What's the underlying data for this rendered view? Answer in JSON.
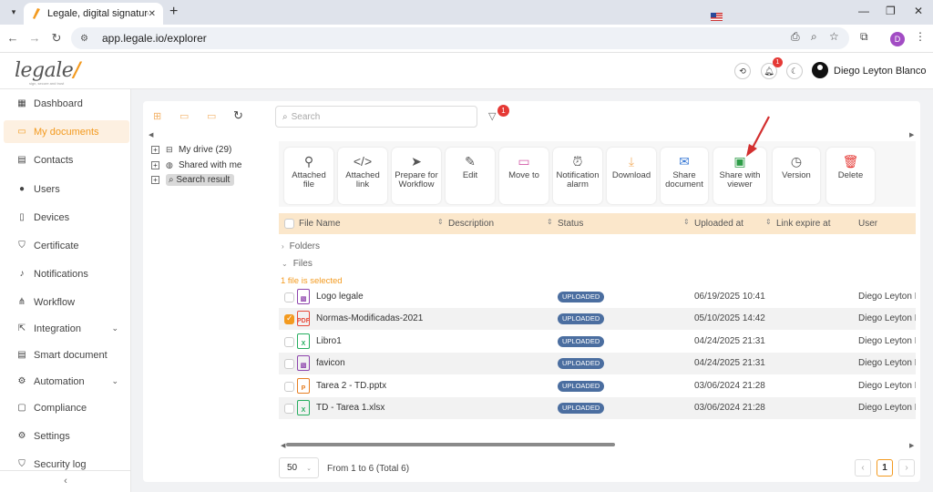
{
  "browser": {
    "tab_title": "Legale, digital signature",
    "url": "app.legale.io/explorer",
    "profile_initial": "D"
  },
  "header": {
    "logo": "legale",
    "logo_tagline": "sign, secure and trust",
    "notification_count": "1",
    "user_name": "Diego Leyton Blanco"
  },
  "sidebar": {
    "items": [
      {
        "label": "Dashboard",
        "icon": "dashboard-icon"
      },
      {
        "label": "My documents",
        "icon": "folder-icon",
        "active": true
      },
      {
        "label": "Contacts",
        "icon": "contacts-icon"
      },
      {
        "label": "Users",
        "icon": "user-icon"
      },
      {
        "label": "Devices",
        "icon": "device-icon"
      },
      {
        "label": "Certificate",
        "icon": "certificate-icon"
      },
      {
        "label": "Notifications",
        "icon": "bell-icon"
      },
      {
        "label": "Workflow",
        "icon": "workflow-icon"
      },
      {
        "label": "Integration",
        "icon": "integration-icon",
        "expandable": true
      },
      {
        "label": "Smart document",
        "icon": "smart-document-icon"
      },
      {
        "label": "Automation",
        "icon": "automation-icon",
        "expandable": true
      },
      {
        "label": "Compliance",
        "icon": "compliance-icon"
      },
      {
        "label": "Settings",
        "icon": "gear-icon"
      },
      {
        "label": "Security log",
        "icon": "shield-icon"
      }
    ],
    "collapse_label": "‹"
  },
  "explorer": {
    "search_placeholder": "Search",
    "filter_count": "1",
    "tree": [
      {
        "label": "My drive (29)",
        "icon": "drive-icon"
      },
      {
        "label": "Shared with me",
        "icon": "globe-icon"
      },
      {
        "label": "Search result",
        "icon": "search-icon",
        "selected": true
      }
    ],
    "actions": [
      {
        "label": "Attached file",
        "icon": "paperclip-icon"
      },
      {
        "label": "Attached link",
        "icon": "code-icon"
      },
      {
        "label": "Prepare for Workflow",
        "icon": "send-icon"
      },
      {
        "label": "Edit",
        "icon": "edit-icon"
      },
      {
        "label": "Move to",
        "icon": "move-folder-icon"
      },
      {
        "label": "Notification alarm",
        "icon": "alarm-icon"
      },
      {
        "label": "Download",
        "icon": "download-icon"
      },
      {
        "label": "Share document",
        "icon": "mail-icon"
      },
      {
        "label": "Share with viewer",
        "icon": "share-viewer-icon"
      },
      {
        "label": "Version",
        "icon": "version-icon"
      },
      {
        "label": "Delete",
        "icon": "trash-icon"
      }
    ],
    "columns": {
      "file_name": "File Name",
      "description": "Description",
      "status": "Status",
      "uploaded_at": "Uploaded at",
      "link_expire_at": "Link expire at",
      "user": "User"
    },
    "folders_label": "Folders",
    "files_label": "Files",
    "selected_info": "1 file is selected",
    "files": [
      {
        "name": "Logo legale",
        "type": "image",
        "status": "UPLOADED",
        "uploaded_at": "06/19/2025 10:41",
        "user": "Diego Leyton Blanco",
        "checked": false
      },
      {
        "name": "Normas-Modificadas-2021",
        "type": "pdf",
        "status": "UPLOADED",
        "uploaded_at": "05/10/2025 14:42",
        "user": "Diego Leyton Blanco",
        "checked": true
      },
      {
        "name": "Libro1",
        "type": "excel",
        "status": "UPLOADED",
        "uploaded_at": "04/24/2025 21:31",
        "user": "Diego Leyton Blanco",
        "checked": false
      },
      {
        "name": "favicon",
        "type": "image",
        "status": "UPLOADED",
        "uploaded_at": "04/24/2025 21:31",
        "user": "Diego Leyton Blanco",
        "checked": false
      },
      {
        "name": "Tarea 2 - TD.pptx",
        "type": "powerpoint",
        "status": "UPLOADED",
        "uploaded_at": "03/06/2024 21:28",
        "user": "Diego Leyton Blanco",
        "checked": false
      },
      {
        "name": "TD - Tarea 1.xlsx",
        "type": "excel",
        "status": "UPLOADED",
        "uploaded_at": "03/06/2024 21:28",
        "user": "Diego Leyton Blanco",
        "checked": false
      }
    ],
    "pagination": {
      "page_size": "50",
      "info": "From 1 to 6 (Total 6)",
      "current_page": "1"
    }
  },
  "colors": {
    "accent": "#f39a1f",
    "status_badge": "#4b6ea0",
    "header_row": "#fbe7cb"
  }
}
